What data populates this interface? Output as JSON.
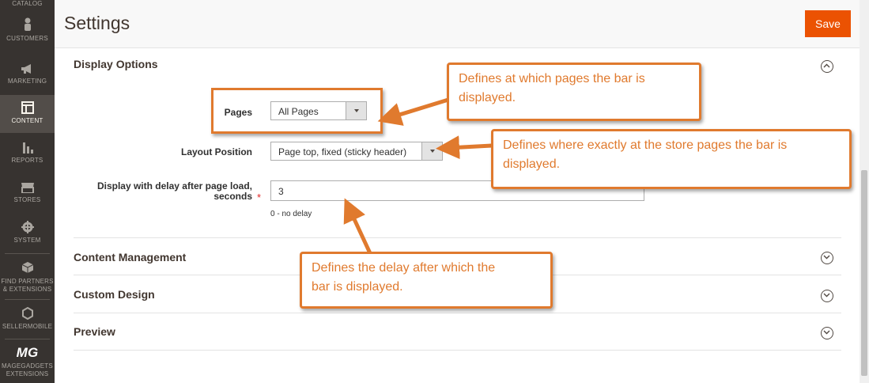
{
  "sidebar": {
    "items": [
      {
        "label": "CATALOG",
        "icon": "catalog-icon"
      },
      {
        "label": "CUSTOMERS",
        "icon": "person-icon"
      },
      {
        "label": "MARKETING",
        "icon": "megaphone-icon"
      },
      {
        "label": "CONTENT",
        "icon": "layout-icon",
        "active": true
      },
      {
        "label": "REPORTS",
        "icon": "bar-chart-icon"
      },
      {
        "label": "STORES",
        "icon": "storefront-icon"
      },
      {
        "label": "SYSTEM",
        "icon": "gear-icon"
      },
      {
        "label_line1": "FIND PARTNERS",
        "label_line2": "& EXTENSIONS",
        "icon": "box-icon"
      },
      {
        "label": "SELLERMOBILE",
        "icon": "hexagon-icon"
      },
      {
        "label_line1": "MAGEGADGETS",
        "label_line2": "EXTENSIONS",
        "icon": "mg-logo-icon",
        "logo_text": "MG"
      }
    ]
  },
  "header": {
    "title": "Settings",
    "save_label": "Save"
  },
  "sections": {
    "display_options": "Display Options",
    "content_management": "Content Management",
    "custom_design": "Custom Design",
    "preview": "Preview"
  },
  "fields": {
    "pages": {
      "label": "Pages",
      "value": "All Pages"
    },
    "layout_position": {
      "label": "Layout Position",
      "value": "Page top, fixed (sticky header)"
    },
    "delay": {
      "label_line1": "Display with delay after page load,",
      "label_line2": "seconds",
      "required_mark": "*",
      "value": "3",
      "note": "0 - no delay"
    }
  },
  "annotations": {
    "pages": {
      "line1": "Defines at which pages the bar is",
      "line2": "displayed."
    },
    "layout": {
      "line1": "Defines where exactly at the store pages the bar is",
      "line2": "displayed."
    },
    "delay": {
      "line1": "Defines the delay after which the",
      "line2": "bar is displayed."
    }
  },
  "colors": {
    "accent": "#eb5202",
    "annotation": "#e07a2e",
    "sidebar_bg": "#373330"
  }
}
